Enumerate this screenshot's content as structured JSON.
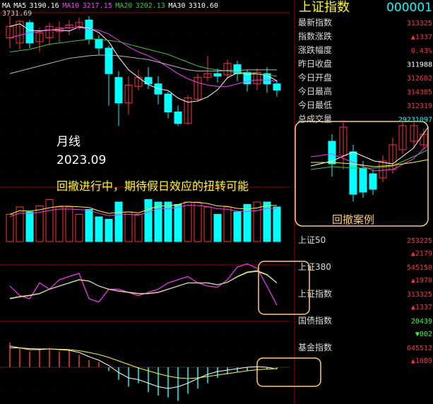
{
  "header": {
    "items": [
      {
        "label": "MA",
        "color": "#ffffff"
      },
      {
        "label": "MA5",
        "color": "#ffffff"
      },
      {
        "label": "3190.16",
        "color": "#ffffff"
      },
      {
        "label": "MA10",
        "color": "#ff33ff"
      },
      {
        "label": "3217.15",
        "color": "#ff33ff"
      },
      {
        "label": "MA20",
        "color": "#33cc33"
      },
      {
        "label": "3202.13",
        "color": "#33cc33"
      },
      {
        "label": "MA30",
        "color": "#ffffff"
      },
      {
        "label": "3310.60",
        "color": "#ffffff"
      }
    ],
    "high_label": "3731.69"
  },
  "annotations": {
    "period": "月线",
    "date": "2023.09",
    "comment": "回撤进行中，期待假日效应的扭转可能",
    "inset_caption": "回撤案例"
  },
  "right_panel": {
    "title": "上证指数",
    "code": "000001",
    "rows": [
      {
        "label": "最新指数",
        "value": "313325",
        "color": "#ff3333"
      },
      {
        "label": "指数涨跌",
        "value": "▲1337",
        "color": "#ff3333"
      },
      {
        "label": "涨跌幅度",
        "value": "0.43%",
        "color": "#ff3333"
      },
      {
        "label": "昨日收盘",
        "value": "311988",
        "color": "#ffffff"
      },
      {
        "label": "今日开盘",
        "value": "312602",
        "color": "#ff3333"
      },
      {
        "label": "今日最高",
        "value": "314385",
        "color": "#ff3333"
      },
      {
        "label": "今日最低",
        "value": "312319",
        "color": "#ff3333"
      },
      {
        "label": "总成交量",
        "value": "29231097",
        "color": "#00ffff"
      }
    ],
    "indices": [
      {
        "name": "上证50",
        "value": "253225",
        "change": "▲2179",
        "color": "#ff3333"
      },
      {
        "name": "上证380",
        "value": "545150",
        "change": "▲1970",
        "color": "#ff3333"
      },
      {
        "name": "上证指数",
        "value": "313325",
        "change": "▲1337",
        "color": "#ff3333"
      },
      {
        "name": "国债指数",
        "value": "20439",
        "change": "▼002",
        "color": "#33ff33"
      },
      {
        "name": "基金指数",
        "value": "645512",
        "change": "▲1089",
        "color": "#ff3333"
      }
    ]
  },
  "colors": {
    "up": "#ff3333",
    "down": "#00ffff",
    "ma5": "#ffffff",
    "ma10": "#ff33ff",
    "ma20": "#33cc33",
    "ma30": "#bbbbbb",
    "highlight": "#ffcc66",
    "grid": "#aa0000",
    "yellow": "#ffff00"
  },
  "chart_data": {
    "type": "candlestick",
    "period": "monthly",
    "candles": [
      {
        "o": 3560,
        "c": 3650,
        "h": 3731,
        "l": 3480
      },
      {
        "o": 3520,
        "c": 3690,
        "h": 3700,
        "l": 3470
      },
      {
        "o": 3680,
        "c": 3520,
        "h": 3700,
        "l": 3480
      },
      {
        "o": 3530,
        "c": 3600,
        "h": 3640,
        "l": 3450
      },
      {
        "o": 3560,
        "c": 3650,
        "h": 3680,
        "l": 3500
      },
      {
        "o": 3610,
        "c": 3640,
        "h": 3690,
        "l": 3520
      },
      {
        "o": 3640,
        "c": 3660,
        "h": 3700,
        "l": 3580
      },
      {
        "o": 3650,
        "c": 3680,
        "h": 3720,
        "l": 3620
      },
      {
        "o": 3700,
        "c": 3550,
        "h": 3730,
        "l": 3510
      },
      {
        "o": 3550,
        "c": 3480,
        "h": 3580,
        "l": 3430
      },
      {
        "o": 3480,
        "c": 3280,
        "h": 3500,
        "l": 3030
      },
      {
        "o": 3250,
        "c": 3050,
        "h": 3300,
        "l": 2870
      },
      {
        "o": 3050,
        "c": 3190,
        "h": 3260,
        "l": 2960
      },
      {
        "o": 3180,
        "c": 3250,
        "h": 3310,
        "l": 3150
      },
      {
        "o": 3250,
        "c": 3200,
        "h": 3330,
        "l": 3160
      },
      {
        "o": 3200,
        "c": 3120,
        "h": 3260,
        "l": 3040
      },
      {
        "o": 3120,
        "c": 2980,
        "h": 3140,
        "l": 2930
      },
      {
        "o": 2980,
        "c": 2890,
        "h": 3030,
        "l": 2870
      },
      {
        "o": 2890,
        "c": 3090,
        "h": 3110,
        "l": 2880
      },
      {
        "o": 3080,
        "c": 3250,
        "h": 3280,
        "l": 3060
      },
      {
        "o": 3250,
        "c": 3280,
        "h": 3420,
        "l": 3220
      },
      {
        "o": 3280,
        "c": 3260,
        "h": 3320,
        "l": 3210
      },
      {
        "o": 3270,
        "c": 3360,
        "h": 3390,
        "l": 3240
      },
      {
        "o": 3350,
        "c": 3280,
        "h": 3380,
        "l": 3220
      },
      {
        "o": 3290,
        "c": 3200,
        "h": 3310,
        "l": 3140
      },
      {
        "o": 3200,
        "c": 3290,
        "h": 3320,
        "l": 3150
      },
      {
        "o": 3280,
        "c": 3200,
        "h": 3330,
        "l": 3130
      },
      {
        "o": 3200,
        "c": 3150,
        "h": 3230,
        "l": 3100
      }
    ],
    "ma10": [
      3560,
      3580,
      3600,
      3610,
      3620,
      3630,
      3640,
      3640,
      3630,
      3620,
      3590,
      3540,
      3490,
      3450,
      3420,
      3380,
      3330,
      3280,
      3240,
      3210,
      3190,
      3180,
      3180,
      3200,
      3220,
      3230,
      3230,
      3220
    ],
    "ma20": [
      3450,
      3460,
      3470,
      3490,
      3510,
      3520,
      3530,
      3540,
      3550,
      3550,
      3540,
      3530,
      3510,
      3490,
      3470,
      3450,
      3430,
      3400,
      3370,
      3340,
      3320,
      3310,
      3300,
      3290,
      3290,
      3280,
      3270,
      3260
    ],
    "ma30": [
      3280,
      3300,
      3320,
      3340,
      3360,
      3380,
      3400,
      3410,
      3420,
      3425,
      3425,
      3420,
      3410,
      3400,
      3390,
      3370,
      3350,
      3330,
      3310,
      3300,
      3300,
      3300,
      3305,
      3305,
      3310,
      3310,
      3310,
      3310
    ],
    "volume": [
      0.55,
      0.7,
      0.6,
      0.72,
      0.85,
      0.7,
      0.7,
      0.55,
      0.65,
      0.5,
      0.45,
      0.8,
      0.6,
      0.55,
      0.85,
      0.8,
      0.8,
      0.75,
      0.8,
      0.8,
      0.7,
      0.55,
      0.7,
      0.6,
      0.75,
      0.8,
      0.8,
      0.7
    ],
    "osc_k": [
      0.5,
      0.35,
      0.3,
      0.55,
      0.45,
      0.6,
      0.65,
      0.7,
      0.3,
      0.25,
      0.45,
      0.45,
      0.4,
      0.35,
      0.4,
      0.45,
      0.55,
      0.6,
      0.65,
      0.55,
      0.5,
      0.48,
      0.6,
      0.8,
      0.85,
      0.78,
      0.5,
      0.2
    ],
    "osc_d": [
      0.3,
      0.33,
      0.35,
      0.38,
      0.45,
      0.5,
      0.55,
      0.6,
      0.58,
      0.5,
      0.45,
      0.42,
      0.4,
      0.38,
      0.38,
      0.4,
      0.45,
      0.5,
      0.55,
      0.55,
      0.55,
      0.52,
      0.56,
      0.65,
      0.72,
      0.74,
      0.68,
      0.55
    ],
    "macd_hist": [
      0.7,
      0.55,
      0.45,
      0.5,
      0.55,
      0.45,
      0.5,
      0.35,
      0.2,
      0.15,
      -0.1,
      -0.35,
      -0.55,
      -0.45,
      -0.7,
      -0.8,
      -0.85,
      -0.95,
      -0.75,
      -0.6,
      -0.45,
      -0.3,
      -0.2,
      -0.15,
      -0.1,
      -0.05,
      -0.05,
      -0.05
    ],
    "macd_dif": [
      0.6,
      0.55,
      0.5,
      0.5,
      0.52,
      0.5,
      0.48,
      0.42,
      0.3,
      0.2,
      0.05,
      -0.15,
      -0.3,
      -0.35,
      -0.45,
      -0.55,
      -0.6,
      -0.55,
      -0.45,
      -0.32,
      -0.2,
      -0.12,
      -0.08,
      -0.04,
      0,
      0.02,
      0,
      -0.05
    ],
    "macd_dea": [
      0.55,
      0.55,
      0.53,
      0.52,
      0.52,
      0.51,
      0.5,
      0.47,
      0.42,
      0.36,
      0.28,
      0.18,
      0.08,
      -0.02,
      -0.1,
      -0.18,
      -0.25,
      -0.3,
      -0.32,
      -0.3,
      -0.26,
      -0.22,
      -0.18,
      -0.14,
      -0.1,
      -0.07,
      -0.05,
      -0.04
    ]
  }
}
